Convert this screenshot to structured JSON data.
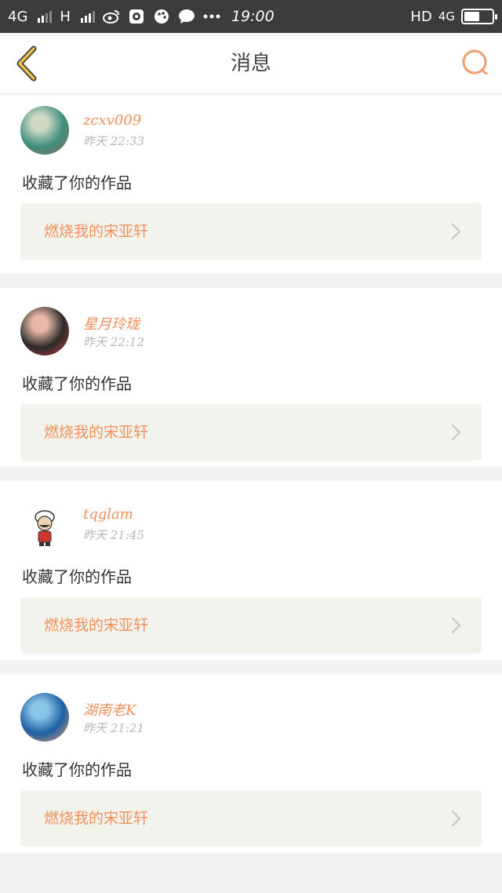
{
  "status_bar": {
    "network_1": "4G",
    "network_2": "H",
    "time": "19:00",
    "hd": "HD",
    "network_right": "4G",
    "battery_level": 0.55
  },
  "nav": {
    "title": "消息",
    "back_icon": "chevron-left-icon",
    "search_icon": "search-icon"
  },
  "messages": [
    {
      "username": "zcxv009",
      "time": "昨天  22:33",
      "action": "收藏了你的作品",
      "work_title": "燃烧我的宋亚轩",
      "avatar_colors": [
        "#3f8f7f",
        "#d0d9c4",
        "#8a6a55"
      ]
    },
    {
      "username": "星月玲珑",
      "time": "昨天  22:12",
      "action": "收藏了你的作品",
      "work_title": "燃烧我的宋亚轩",
      "avatar_colors": [
        "#2b2b2b",
        "#e9b8a8",
        "#c23b3b"
      ]
    },
    {
      "username": "tqglam",
      "time": "昨天  21:45",
      "action": "收藏了你的作品",
      "work_title": "燃烧我的宋亚轩",
      "avatar_colors": [
        "#ffffff",
        "#f0d2b0",
        "#d0342c"
      ]
    },
    {
      "username": "湖南老K",
      "time": "昨天  21:21",
      "action": "收藏了你的作品",
      "work_title": "燃烧我的宋亚轩",
      "avatar_colors": [
        "#1e5fa3",
        "#8bc6e8",
        "#e6a16b"
      ]
    }
  ],
  "colors": {
    "accent": "#f0905a",
    "card_bg": "#ffffff",
    "work_bg": "#f3f3ee",
    "page_bg": "#f3f3f3",
    "back_icon": "#e8c24a"
  }
}
